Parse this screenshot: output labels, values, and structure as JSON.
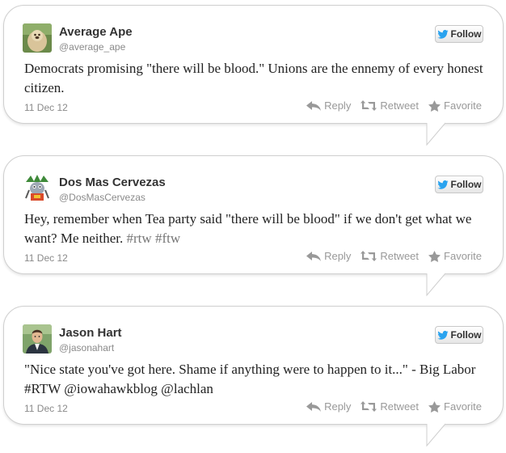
{
  "tweets": [
    {
      "name": "Average Ape",
      "handle": "@average_ape",
      "text_parts": [
        "Democrats promising \"there will be blood.\" Unions are the ennemy of every honest citizen."
      ],
      "hashtags": [],
      "date": "11 Dec 12",
      "follow_label": "Follow",
      "reply_label": "Reply",
      "retweet_label": "Retweet",
      "favorite_label": "Favorite",
      "avatar_icon": "gibbon-avatar"
    },
    {
      "name": "Dos Mas Cervezas",
      "handle": "@DosMasCervezas",
      "text_main": "Hey, remember when Tea party said \"there will be blood\" if we don't get what we want? Me neither.",
      "hashtags": [
        "#rtw",
        "#ftw"
      ],
      "date": "11 Dec 12",
      "follow_label": "Follow",
      "reply_label": "Reply",
      "retweet_label": "Retweet",
      "favorite_label": "Favorite",
      "avatar_icon": "mascot-avatar"
    },
    {
      "name": "Jason Hart",
      "handle": "@jasonahart",
      "text_main": "\"Nice state you've got here. Shame if anything were to happen to it...\" - Big Labor #RTW @iowahawkblog @lachlan",
      "hashtags": [],
      "date": "11 Dec 12",
      "follow_label": "Follow",
      "reply_label": "Reply",
      "retweet_label": "Retweet",
      "favorite_label": "Favorite",
      "avatar_icon": "person-avatar"
    }
  ],
  "colors": {
    "border": "#cfcfcf",
    "twitter_blue": "#2aa3ef",
    "muted": "#999999"
  }
}
